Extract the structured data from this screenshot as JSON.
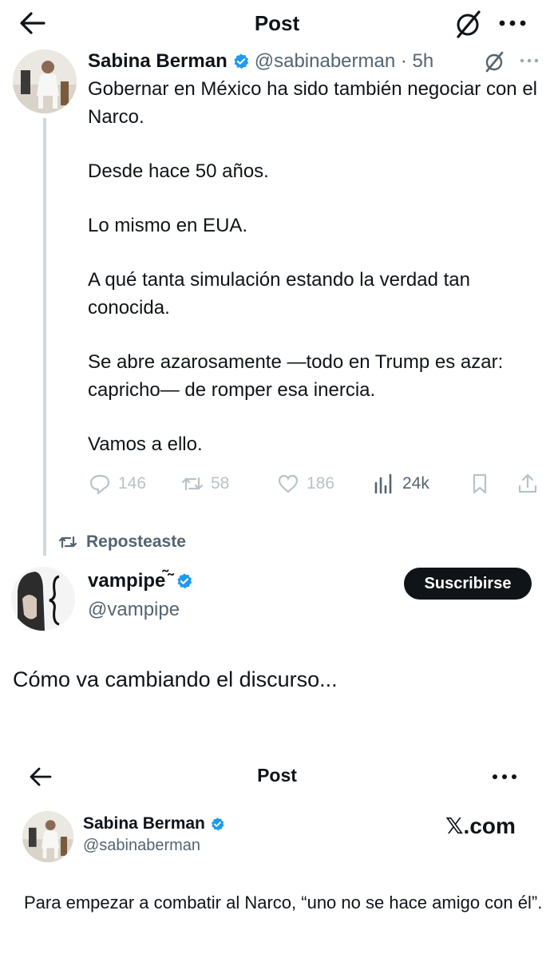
{
  "header": {
    "title": "Post"
  },
  "tweet1": {
    "name": "Sabina Berman",
    "handle": "@sabinaberman · 5h",
    "paragraphs": [
      "Gobernar en México ha sido también negociar con el Narco.",
      "Desde hace 50 años.",
      "Lo mismo en EUA.",
      "A qué tanta simulación estando la verdad tan conocida.",
      "Se abre azarosamente —todo en Trump es azar: capricho— de romper esa inercia.",
      "Vamos a ello."
    ],
    "actions": {
      "replies": "146",
      "reposts": "58",
      "likes": "186",
      "views": "24k"
    }
  },
  "repost_label": "Reposteaste",
  "tweet2": {
    "name": "vampipe ͂̃",
    "handle": "@vampipe",
    "subscribe_label": "Suscribirse",
    "text": "Cómo va cambiando el discurso..."
  },
  "embed": {
    "header_title": "Post",
    "name": "Sabina Berman",
    "handle": "@sabinaberman",
    "watermark": "𝕏.com",
    "text": "Para empezar a combatir al Narco, “uno no se hace amigo con él”."
  },
  "colors": {
    "text": "#0f1419",
    "secondary": "#536471",
    "verified": "#1d9bf0",
    "muted_icons": "#b8c2c9"
  }
}
